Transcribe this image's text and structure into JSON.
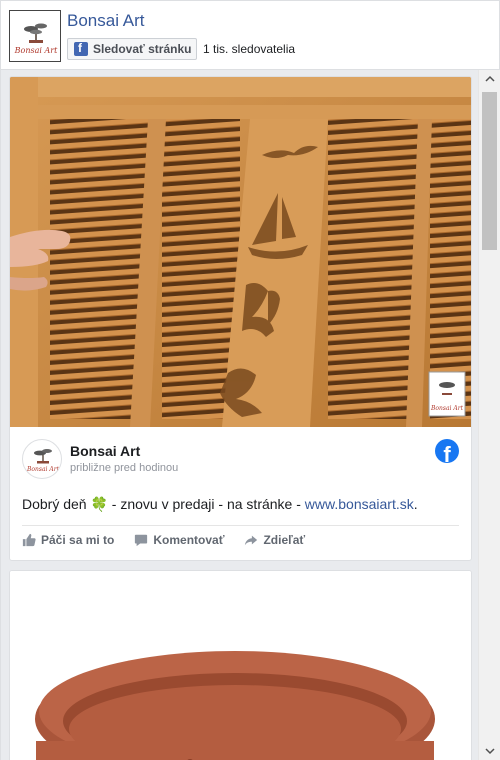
{
  "header": {
    "page_name": "Bonsai Art",
    "follow_label": "Sledovať stránku",
    "followers": "1 tis. sledovatelia",
    "logo_text": "Bonsai Art"
  },
  "post": {
    "author": "Bonsai Art",
    "time": "približne pred hodinou",
    "text": "Dobrý deň ",
    "text_emoji": "🍀",
    "text_middle": " - znovu v predaji - na stránke - ",
    "link": "www.bonsaiart.sk",
    "text_end": ".",
    "actions": {
      "like": "Páči sa mi to",
      "comment": "Komentovať",
      "share": "Zdieľať"
    },
    "watermark": "Bonsai Art"
  },
  "colors": {
    "link": "#365899",
    "facebook": "#1877f2",
    "bamboo": "#c8883f"
  }
}
